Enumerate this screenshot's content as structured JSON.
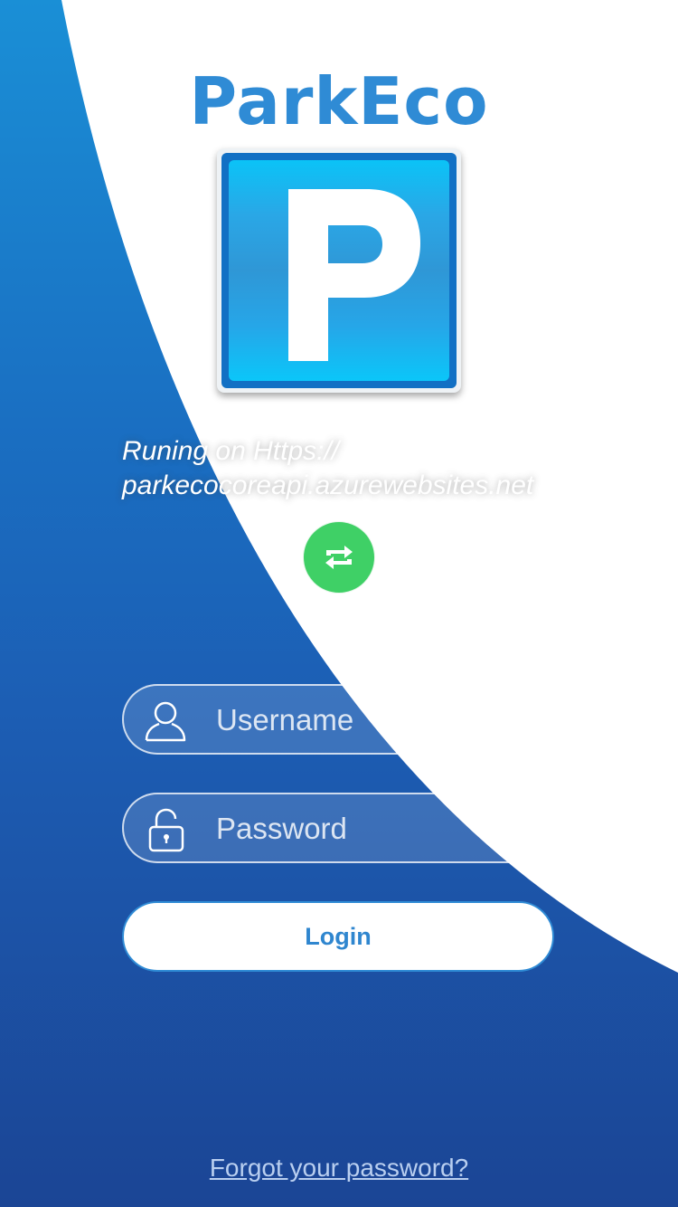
{
  "app": {
    "title": "ParkEco"
  },
  "logo": {
    "letter": "P"
  },
  "server": {
    "line1": "Runing on Https://",
    "line2": "parkecocoreapi.azurewebsites.net"
  },
  "refresh": {
    "icon": "refresh-icon"
  },
  "form": {
    "username": {
      "value": "",
      "placeholder": "Username",
      "icon": "user-icon"
    },
    "password": {
      "value": "",
      "placeholder": "Password",
      "icon": "lock-icon"
    },
    "login_label": "Login"
  },
  "footer": {
    "forgot_label": "Forgot your password?"
  },
  "colors": {
    "brand": "#2f8bd5",
    "background_top": "#1a8fd6",
    "background_bottom": "#1b4595",
    "refresh_button": "#3fd066"
  }
}
